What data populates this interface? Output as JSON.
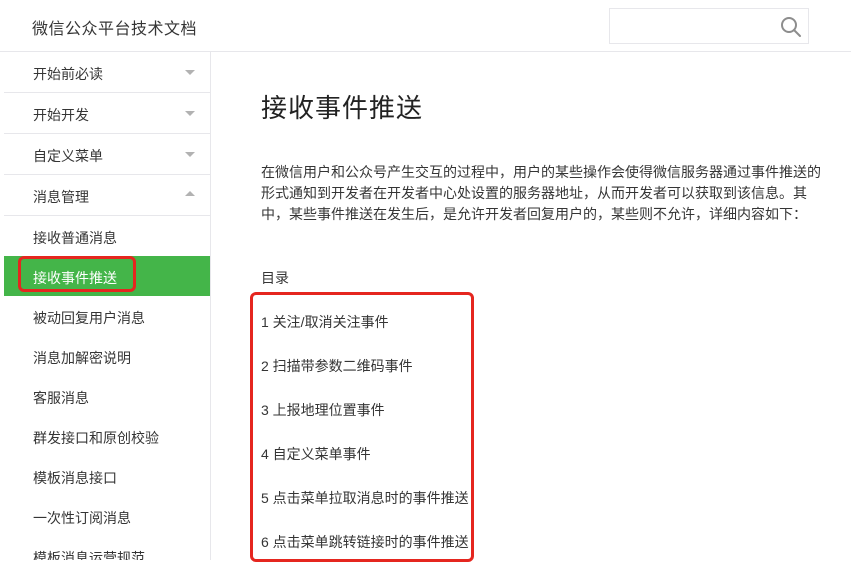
{
  "header": {
    "title": "微信公众平台技术文档",
    "search": {
      "value": "",
      "placeholder": ""
    }
  },
  "sidebar": {
    "groups": [
      {
        "label": "开始前必读",
        "expanded": false
      },
      {
        "label": "开始开发",
        "expanded": false
      },
      {
        "label": "自定义菜单",
        "expanded": false
      },
      {
        "label": "消息管理",
        "expanded": true
      }
    ],
    "sub_items": [
      {
        "label": "接收普通消息"
      },
      {
        "label": "接收事件推送",
        "active": true
      },
      {
        "label": "被动回复用户消息"
      },
      {
        "label": "消息加解密说明"
      },
      {
        "label": "客服消息"
      },
      {
        "label": "群发接口和原创校验"
      },
      {
        "label": "模板消息接口"
      },
      {
        "label": "一次性订阅消息"
      },
      {
        "label": "模板消息运营规范"
      }
    ]
  },
  "main": {
    "title": "接收事件推送",
    "intro": "在微信用户和公众号产生交互的过程中，用户的某些操作会使得微信服务器通过事件推送的形式通知到开发者在开发者中心处设置的服务器地址，从而开发者可以获取到该信息。其中，某些事件推送在发生后，是允许开发者回复用户的，某些则不允许，详细内容如下：",
    "toc_title": "目录",
    "toc": [
      "1 关注/取消关注事件",
      "2 扫描带参数二维码事件",
      "3 上报地理位置事件",
      "4 自定义菜单事件",
      "5 点击菜单拉取消息时的事件推送",
      "6 点击菜单跳转链接时的事件推送"
    ]
  },
  "colors": {
    "accent": "#44b549",
    "highlight": "#e5261f",
    "border": "#e7e7eb"
  }
}
